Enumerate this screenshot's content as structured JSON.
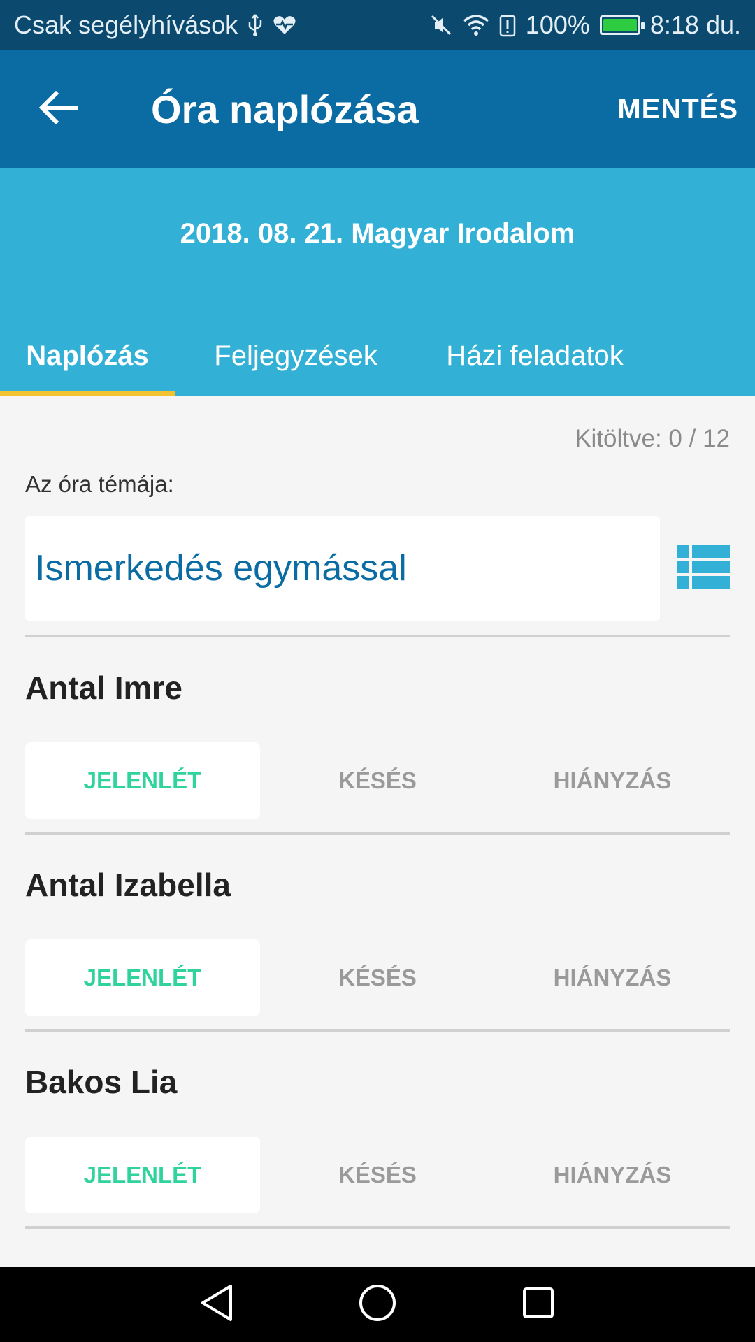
{
  "status_bar": {
    "carrier_text": "Csak segélyhívások",
    "battery_percent": "100%",
    "time": "8:18 du.",
    "battery_level": 1.0,
    "icons": [
      "usb-icon",
      "health-icon",
      "muted-icon",
      "wifi-icon",
      "alert-icon",
      "battery-icon"
    ]
  },
  "app_bar": {
    "title": "Óra naplózása",
    "save_label": "MENTÉS"
  },
  "lesson": {
    "title": "2018. 08. 21. Magyar Irodalom"
  },
  "tabs": [
    {
      "label": "Naplózás",
      "active": true
    },
    {
      "label": "Feljegyzések",
      "active": false
    },
    {
      "label": "Házi feladatok",
      "active": false
    }
  ],
  "progress": {
    "text": "Kitöltve: 0 / 12"
  },
  "topic": {
    "label": "Az óra témája:",
    "value": "Ismerkedés egymással"
  },
  "attendance_options": [
    "JELENLÉT",
    "KÉSÉS",
    "HIÁNYZÁS"
  ],
  "students": [
    {
      "name": "Antal Imre",
      "selected": "JELENLÉT"
    },
    {
      "name": "Antal Izabella",
      "selected": "JELENLÉT"
    },
    {
      "name": "Bakos Lia",
      "selected": "JELENLÉT"
    }
  ],
  "colors": {
    "status_bar": "#0b4a6e",
    "app_bar": "#0a6ca3",
    "header_band": "#33b0d6",
    "tab_indicator": "#f2c230",
    "present_green": "#30d39c",
    "topic_text": "#0a6ca3"
  }
}
